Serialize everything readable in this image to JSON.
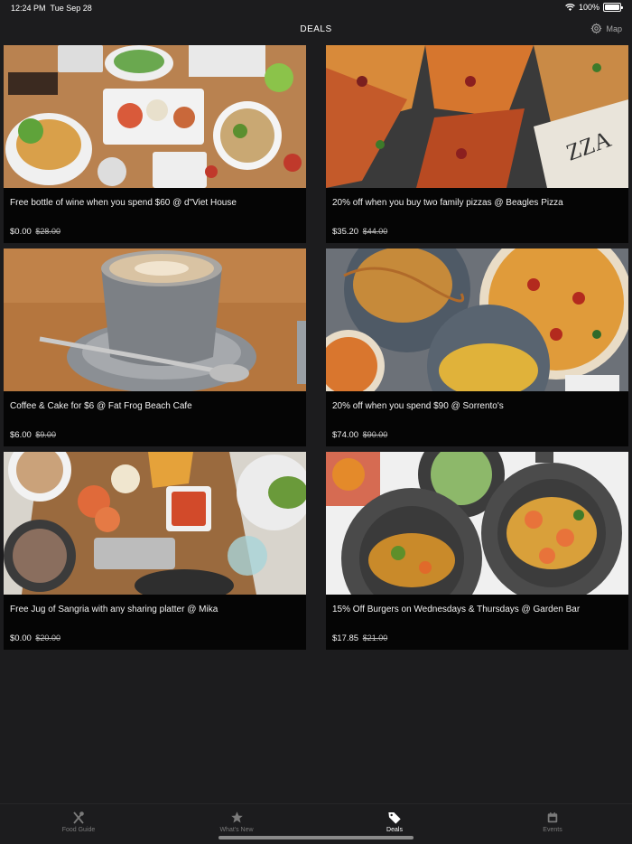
{
  "status_bar": {
    "time": "12:24 PM",
    "date": "Tue Sep 28",
    "battery": "100%"
  },
  "nav": {
    "title": "DEALS",
    "map_label": "Map"
  },
  "deals": [
    {
      "title": "Free bottle of wine when you spend $60 @ d\"Viet House",
      "price": "$0.00",
      "old_price": "$28.00",
      "image": "vietnamese-food-spread"
    },
    {
      "title": "20% off when you buy two family pizzas @ Beagles Pizza",
      "price": "$35.20",
      "old_price": "$44.00",
      "image": "pizza-slices"
    },
    {
      "title": "Coffee & Cake for $6 @ Fat Frog Beach Cafe",
      "price": "$6.00",
      "old_price": "$9.00",
      "image": "latte-cup"
    },
    {
      "title": "20% off when you spend $90 @ Sorrento's",
      "price": "$74.00",
      "old_price": "$90.00",
      "image": "pasta-and-pizza"
    },
    {
      "title": "Free Jug of Sangria with any sharing platter @ Mika",
      "price": "$0.00",
      "old_price": "$20.00",
      "image": "seafood-platter"
    },
    {
      "title": "15% Off Burgers on Wednesdays & Thursdays @ Garden Bar",
      "price": "$17.85",
      "old_price": "$21.00",
      "image": "prawn-pasta-dishes"
    }
  ],
  "tabs": [
    {
      "label": "Food Guide",
      "icon": "fork-knife-icon"
    },
    {
      "label": "What's New",
      "icon": "star-icon"
    },
    {
      "label": "Deals",
      "icon": "tag-icon",
      "active": true
    },
    {
      "label": "Events",
      "icon": "calendar-icon"
    }
  ]
}
